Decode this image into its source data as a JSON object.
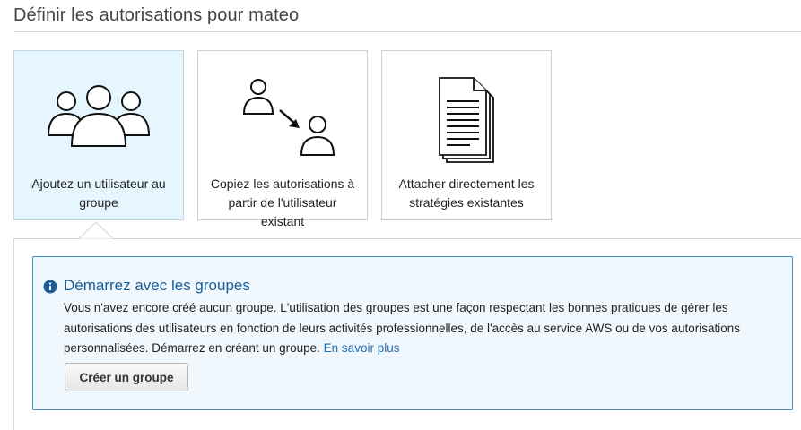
{
  "page": {
    "title": "Définir les autorisations pour mateo"
  },
  "options": [
    {
      "label": "Ajoutez un utilisateur au groupe",
      "icon": "users-group-icon",
      "selected": true
    },
    {
      "label": "Copiez les autorisations à partir de l'utilisateur existant",
      "icon": "copy-user-permissions-icon",
      "selected": false
    },
    {
      "label": "Attacher directement les stratégies existantes",
      "icon": "policy-documents-icon",
      "selected": false
    }
  ],
  "info": {
    "icon": "info-icon",
    "title": "Démarrez avec les groupes",
    "body": "Vous n'avez encore créé aucun groupe. L'utilisation des groupes est une façon respectant les bonnes pratiques de gérer les autorisations des utilisateurs en fonction de leurs activités professionnelles, de l'accès au service AWS ou de vos autorisations personnalisées. Démarrez en créant un groupe.",
    "link": "En savoir plus",
    "button": "Créer un groupe"
  },
  "colors": {
    "selected_card_bg": "#e6f6fe",
    "info_border": "#3e8fc4",
    "info_bg": "#f1f8fd",
    "info_title": "#1a5c95",
    "link": "#1f6fb4"
  }
}
